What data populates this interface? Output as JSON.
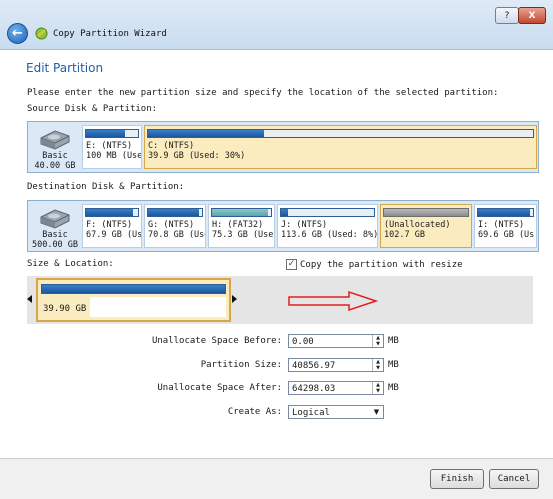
{
  "window": {
    "title": "Copy Partition Wizard",
    "help_label": "?",
    "close_label": "X"
  },
  "page": {
    "heading": "Edit Partition",
    "instructions": "Please enter the new partition size and specify the location of the selected partition:"
  },
  "source": {
    "label": "Source Disk & Partition:",
    "disk": {
      "type": "Basic",
      "size": "40.00 GB",
      "icon": "hard-disk-icon"
    },
    "partitions": [
      {
        "name": "E: (NTFS)",
        "info": "100 MB (Used",
        "used_fraction": 0.75,
        "selected": false
      },
      {
        "name": "C: (NTFS)",
        "info": "39.9 GB (Used: 30%)",
        "used_fraction": 0.3,
        "selected": true
      }
    ]
  },
  "destination": {
    "label": "Destination Disk & Partition:",
    "disk": {
      "type": "Basic",
      "size": "500.00 GB",
      "icon": "hard-disk-icon"
    },
    "partitions": [
      {
        "name": "F: (NTFS)",
        "info": "67.9 GB (Use",
        "used_fraction": 0.9,
        "kind": "ntfs",
        "selected": false
      },
      {
        "name": "G: (NTFS)",
        "info": "70.8 GB (Use",
        "used_fraction": 0.95,
        "kind": "ntfs",
        "selected": false
      },
      {
        "name": "H: (FAT32)",
        "info": "75.3 GB (Use",
        "used_fraction": 0.95,
        "kind": "fat32",
        "selected": false
      },
      {
        "name": "J: (NTFS)",
        "info": "113.6 GB (Used: 8%)",
        "used_fraction": 0.08,
        "kind": "ntfs",
        "selected": false
      },
      {
        "name": "(Unallocated)",
        "info": "102.7 GB",
        "used_fraction": 0,
        "kind": "unallocated",
        "selected": true
      },
      {
        "name": "I: (NTFS)",
        "info": "69.6 GB (Us",
        "used_fraction": 0.95,
        "kind": "ntfs",
        "selected": false
      }
    ]
  },
  "size_location": {
    "label": "Size & Location:",
    "copy_with_resize_label": "Copy the partition with resize",
    "copy_with_resize_checked": true,
    "partition_size_text": "39.90 GB",
    "used_fraction": 1.0,
    "arrow_color": "#e02020"
  },
  "fields": {
    "unalloc_before": {
      "label": "Unallocate Space Before:",
      "value": "0.00",
      "unit": "MB"
    },
    "partition_size": {
      "label": "Partition Size:",
      "value": "40856.97",
      "unit": "MB"
    },
    "unalloc_after": {
      "label": "Unallocate Space After:",
      "value": "64298.03",
      "unit": "MB"
    },
    "create_as": {
      "label": "Create As:",
      "value": "Logical"
    }
  },
  "buttons": {
    "finish": "Finish",
    "cancel": "Cancel"
  },
  "colors": {
    "accent": "#1f5ea8",
    "selected_partition": "#fbecc0",
    "partition_fill": "#1b56a0"
  }
}
